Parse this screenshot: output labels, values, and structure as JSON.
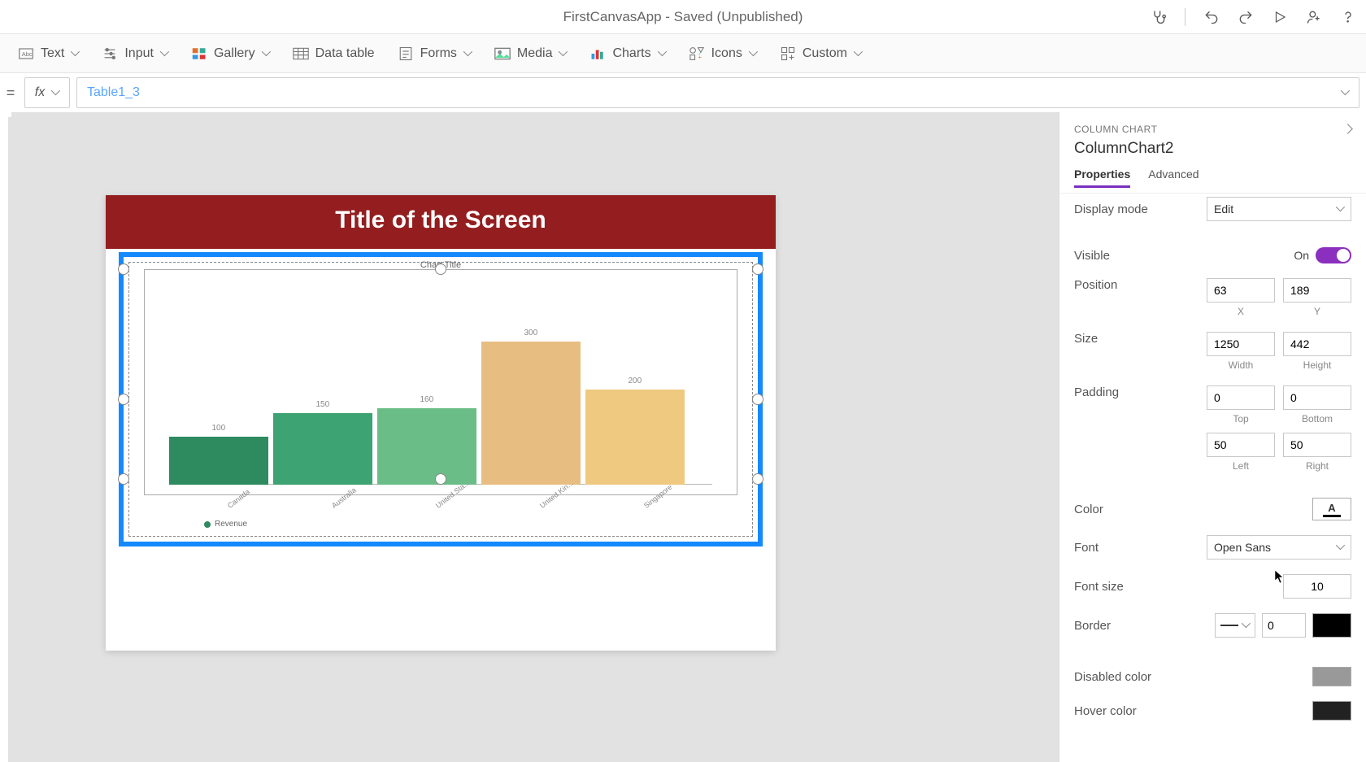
{
  "titlebar": {
    "app_title": "FirstCanvasApp - Saved (Unpublished)"
  },
  "ribbon": {
    "text": "Text",
    "input": "Input",
    "gallery": "Gallery",
    "datatable": "Data table",
    "forms": "Forms",
    "media": "Media",
    "charts": "Charts",
    "icons": "Icons",
    "custom": "Custom"
  },
  "formula": {
    "fx": "fx",
    "value": "Table1_3"
  },
  "canvas": {
    "screen_title": "Title of the Screen",
    "chart_title": "Chart Title",
    "legend_item": "Revenue"
  },
  "chart_data": {
    "type": "bar",
    "title": "Chart Title",
    "categories": [
      "Canada",
      "Australia",
      "United Sta...",
      "United Kin...",
      "Singapore"
    ],
    "values": [
      100,
      150,
      160,
      300,
      200
    ],
    "colors": [
      "#2d8b5f",
      "#3ea372",
      "#6bbd87",
      "#e8bd82",
      "#eec97f"
    ],
    "ylim": [
      0,
      300
    ],
    "series_name": "Revenue"
  },
  "panel": {
    "category": "COLUMN CHART",
    "title": "ColumnChart2",
    "tabs": {
      "properties": "Properties",
      "advanced": "Advanced"
    },
    "props": {
      "display_mode": {
        "label": "Display mode",
        "value": "Edit"
      },
      "visible": {
        "label": "Visible",
        "value": "On"
      },
      "position": {
        "label": "Position",
        "x": "63",
        "y": "189",
        "xlabel": "X",
        "ylabel": "Y"
      },
      "size": {
        "label": "Size",
        "w": "1250",
        "h": "442",
        "wlabel": "Width",
        "hlabel": "Height"
      },
      "padding": {
        "label": "Padding",
        "top": "0",
        "bottom": "0",
        "left": "50",
        "right": "50",
        "toplabel": "Top",
        "bottomlabel": "Bottom",
        "leftlabel": "Left",
        "rightlabel": "Right"
      },
      "color": {
        "label": "Color"
      },
      "font": {
        "label": "Font",
        "value": "Open Sans"
      },
      "font_size": {
        "label": "Font size",
        "value": "10"
      },
      "border": {
        "label": "Border",
        "width": "0",
        "color": "#000000"
      },
      "disabled_color": {
        "label": "Disabled color",
        "color": "#999999"
      },
      "hover_color": {
        "label": "Hover color",
        "color": "#222222"
      }
    }
  }
}
